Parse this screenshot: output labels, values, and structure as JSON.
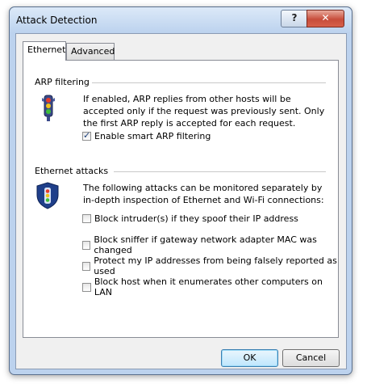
{
  "window": {
    "title": "Attack Detection",
    "help_label": "?",
    "close_label": "✕"
  },
  "tabs": [
    {
      "label": "Ethernet"
    },
    {
      "label": "Advanced"
    }
  ],
  "arp": {
    "heading": "ARP filtering",
    "description": "If enabled, ARP replies from other hosts will be accepted only if the request was previously sent. Only the first ARP reply is accepted for each request.",
    "checkbox": {
      "label": "Enable smart ARP filtering",
      "checked": true
    },
    "icon": "traffic-light-icon"
  },
  "ethernet": {
    "heading": "Ethernet attacks",
    "description": "The following attacks can be monitored separately by in-depth inspection of Ethernet and Wi-Fi connections:",
    "icon": "shield-traffic-light-icon",
    "options": [
      {
        "label": "Block intruder(s) if they spoof their IP address",
        "checked": false
      },
      {
        "label": "Block sniffer if gateway network adapter MAC was changed",
        "checked": false
      },
      {
        "label": "Protect my IP addresses from being falsely reported as used",
        "checked": false
      },
      {
        "label": "Block host when it enumerates other computers on LAN",
        "checked": false
      }
    ]
  },
  "buttons": {
    "ok": "OK",
    "cancel": "Cancel"
  }
}
